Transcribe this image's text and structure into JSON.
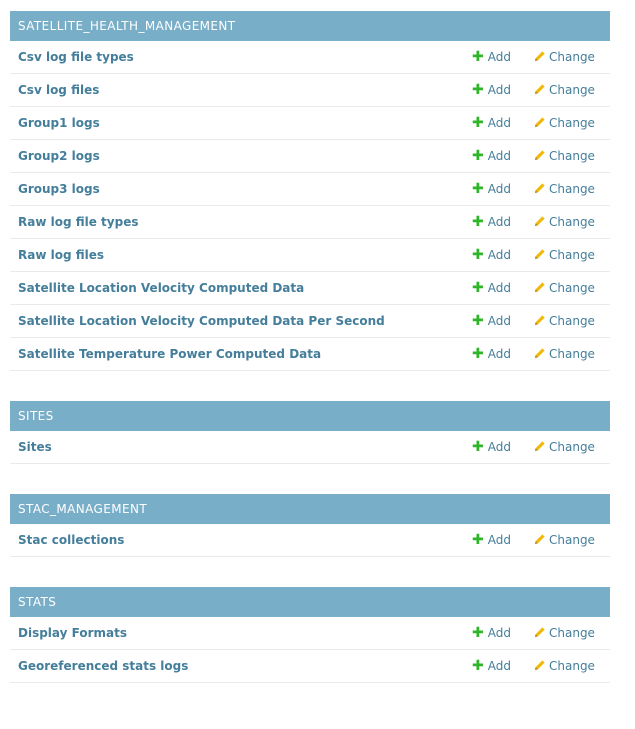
{
  "actions": {
    "add_label": "Add",
    "change_label": "Change"
  },
  "colors": {
    "caption_bg": "#79aec8",
    "link": "#447e9b",
    "add_icon": "#2fb42a",
    "change_icon": "#efb80b"
  },
  "icons": {
    "add": "plus-icon",
    "change": "pencil-icon"
  },
  "modules": [
    {
      "title": "SATELLITE_HEALTH_MANAGEMENT",
      "models": [
        "Csv log file types",
        "Csv log files",
        "Group1 logs",
        "Group2 logs",
        "Group3 logs",
        "Raw log file types",
        "Raw log files",
        "Satellite Location Velocity Computed Data",
        "Satellite Location Velocity Computed Data Per Second",
        "Satellite Temperature Power Computed Data"
      ]
    },
    {
      "title": "SITES",
      "models": [
        "Sites"
      ]
    },
    {
      "title": "STAC_MANAGEMENT",
      "models": [
        "Stac collections"
      ]
    },
    {
      "title": "STATS",
      "models": [
        "Display Formats",
        "Georeferenced stats logs"
      ]
    }
  ]
}
